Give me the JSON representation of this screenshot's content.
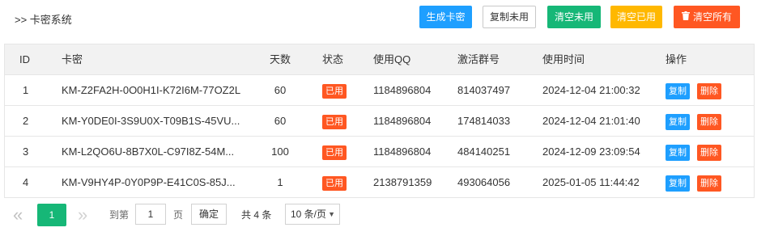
{
  "header": {
    "title": ">> 卡密系统",
    "buttons": {
      "generate": "生成卡密",
      "copy_unused": "复制未用",
      "clear_unused": "清空未用",
      "clear_used": "清空已用",
      "clear_all": "清空所有"
    }
  },
  "table": {
    "columns": [
      "ID",
      "卡密",
      "天数",
      "状态",
      "使用QQ",
      "激活群号",
      "使用时间",
      "操作"
    ],
    "rows": [
      {
        "id": "1",
        "card": "KM-Z2FA2H-0O0H1I-K72I6M-77OZ2L",
        "days": "60",
        "status": "已用",
        "qq": "1184896804",
        "group": "814037497",
        "time": "2024-12-04 21:00:32",
        "copy": "复制",
        "del": "删除"
      },
      {
        "id": "2",
        "card": "KM-Y0DE0I-3S9U0X-T09B1S-45VU...",
        "days": "60",
        "status": "已用",
        "qq": "1184896804",
        "group": "174814033",
        "time": "2024-12-04 21:01:40",
        "copy": "复制",
        "del": "删除"
      },
      {
        "id": "3",
        "card": "KM-L2QO6U-8B7X0L-C97I8Z-54M...",
        "days": "100",
        "status": "已用",
        "qq": "1184896804",
        "group": "484140251",
        "time": "2024-12-09 23:09:54",
        "copy": "复制",
        "del": "删除"
      },
      {
        "id": "4",
        "card": "KM-V9HY4P-0Y0P9P-E41C0S-85J...",
        "days": "1",
        "status": "已用",
        "qq": "2138791359",
        "group": "493064056",
        "time": "2025-01-05 11:44:42",
        "copy": "复制",
        "del": "删除"
      }
    ]
  },
  "pager": {
    "prev": "«",
    "current": "1",
    "next": "»",
    "goto_label": "到第",
    "page_value": "1",
    "page_unit": "页",
    "confirm": "确定",
    "total": "共 4 条",
    "page_size": "10 条/页"
  },
  "colors": {
    "blue": "#1e9fff",
    "green": "#16b777",
    "yellow": "#ffb800",
    "red": "#ff5722"
  }
}
